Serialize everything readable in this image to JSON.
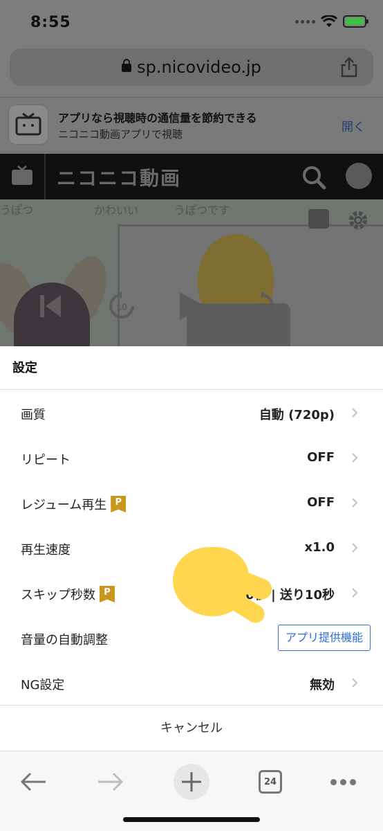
{
  "status_bar": {
    "time": "8:55"
  },
  "browser": {
    "url": "sp.nicovideo.jp",
    "tab_count": "24"
  },
  "app_banner": {
    "title": "アプリなら視聴時の通信量を節約できる",
    "subtitle": "ニコニコ動画アプリで視聴",
    "open_label": "開く"
  },
  "header": {
    "logo_text": "ニコニコ動画"
  },
  "video": {
    "comments": [
      "うぽつ",
      "かわいい",
      "うぽつです",
      "かわ"
    ],
    "skip_back_label": "10",
    "skip_forward_label": "10"
  },
  "settings": {
    "title": "設定",
    "rows": [
      {
        "label": "画質",
        "value": "自動 (720p)",
        "premium": false
      },
      {
        "label": "リピート",
        "value": "OFF",
        "premium": false
      },
      {
        "label": "レジューム再生",
        "value": "OFF",
        "premium": true
      },
      {
        "label": "再生速度",
        "value": "x1.0",
        "premium": false
      },
      {
        "label": "スキップ秒数",
        "value": "10秒 | 送り10秒",
        "premium": true
      },
      {
        "label": "音量の自動調整",
        "button": "アプリ提供機能"
      },
      {
        "label": "NG設定",
        "value": "無効",
        "premium": false
      }
    ],
    "premium_badge": "P",
    "cancel_label": "キャンセル"
  },
  "colors": {
    "premium_badge": "#c9961e",
    "app_feature_blue": "#2b6fd4",
    "pointer_yellow": "#ffd64d"
  }
}
